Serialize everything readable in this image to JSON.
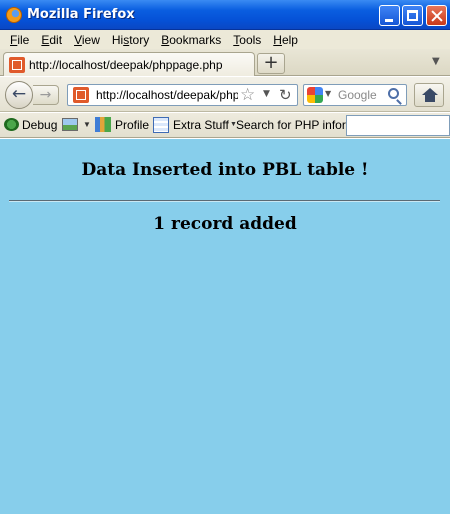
{
  "window": {
    "title": "Mozilla Firefox",
    "icon": "firefox-logo-icon"
  },
  "menu": {
    "items": [
      {
        "accel": "F",
        "rest": "ile"
      },
      {
        "accel": "E",
        "rest": "dit"
      },
      {
        "accel": "V",
        "rest": "iew"
      },
      {
        "accel": "",
        "pre": "Hi",
        "accel2": "s",
        "rest": "tory"
      },
      {
        "accel": "B",
        "rest": "ookmarks"
      },
      {
        "accel": "T",
        "rest": "ools"
      },
      {
        "accel": "H",
        "rest": "elp"
      }
    ]
  },
  "tabs": {
    "active_title": "http://localhost/deepak/phppage.php",
    "new_tab_label": "+"
  },
  "nav": {
    "url": "http://localhost/deepak/phppage.php",
    "search_placeholder": "Google",
    "search_engine_icon": "google-icon"
  },
  "toolbar": {
    "debug_label": "Debug",
    "profile_label": "Profile",
    "extra_label": "Extra Stuff",
    "search_label": "Search for PHP information:",
    "search_value": ""
  },
  "content": {
    "heading": "Data Inserted into PBL table !",
    "result": "1 record added",
    "background_color": "#87ceeb"
  }
}
